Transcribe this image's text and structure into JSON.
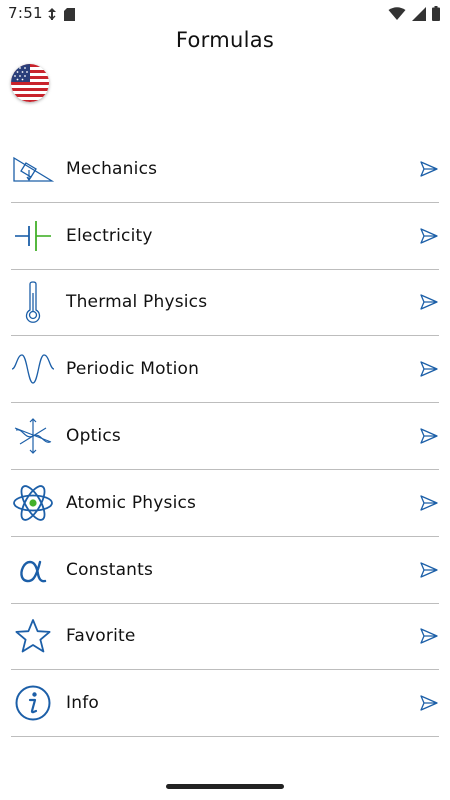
{
  "status_bar": {
    "time": "7:51",
    "left_icons": [
      "data-saver-icon",
      "sd-card-icon"
    ],
    "right_icons": [
      "wifi-icon",
      "signal-icon",
      "battery-icon"
    ]
  },
  "header": {
    "title": "Formulas",
    "language_flag": "us-flag-icon"
  },
  "menu": {
    "items": [
      {
        "label": "Mechanics",
        "icon": "inclined-plane-icon"
      },
      {
        "label": "Electricity",
        "icon": "capacitor-icon"
      },
      {
        "label": "Thermal Physics",
        "icon": "thermometer-icon"
      },
      {
        "label": "Periodic Motion",
        "icon": "sine-wave-icon"
      },
      {
        "label": "Optics",
        "icon": "polarized-light-icon"
      },
      {
        "label": "Atomic Physics",
        "icon": "atom-icon"
      },
      {
        "label": "Constants",
        "icon": "alpha-icon"
      },
      {
        "label": "Favorite",
        "icon": "star-icon"
      },
      {
        "label": "Info",
        "icon": "info-icon"
      }
    ],
    "arrow_icon": "send-arrow-icon"
  },
  "colors": {
    "icon_blue": "#1c5fa8",
    "accent_green": "#43b02a",
    "divider": "#bdbdbd",
    "text": "#111111"
  }
}
